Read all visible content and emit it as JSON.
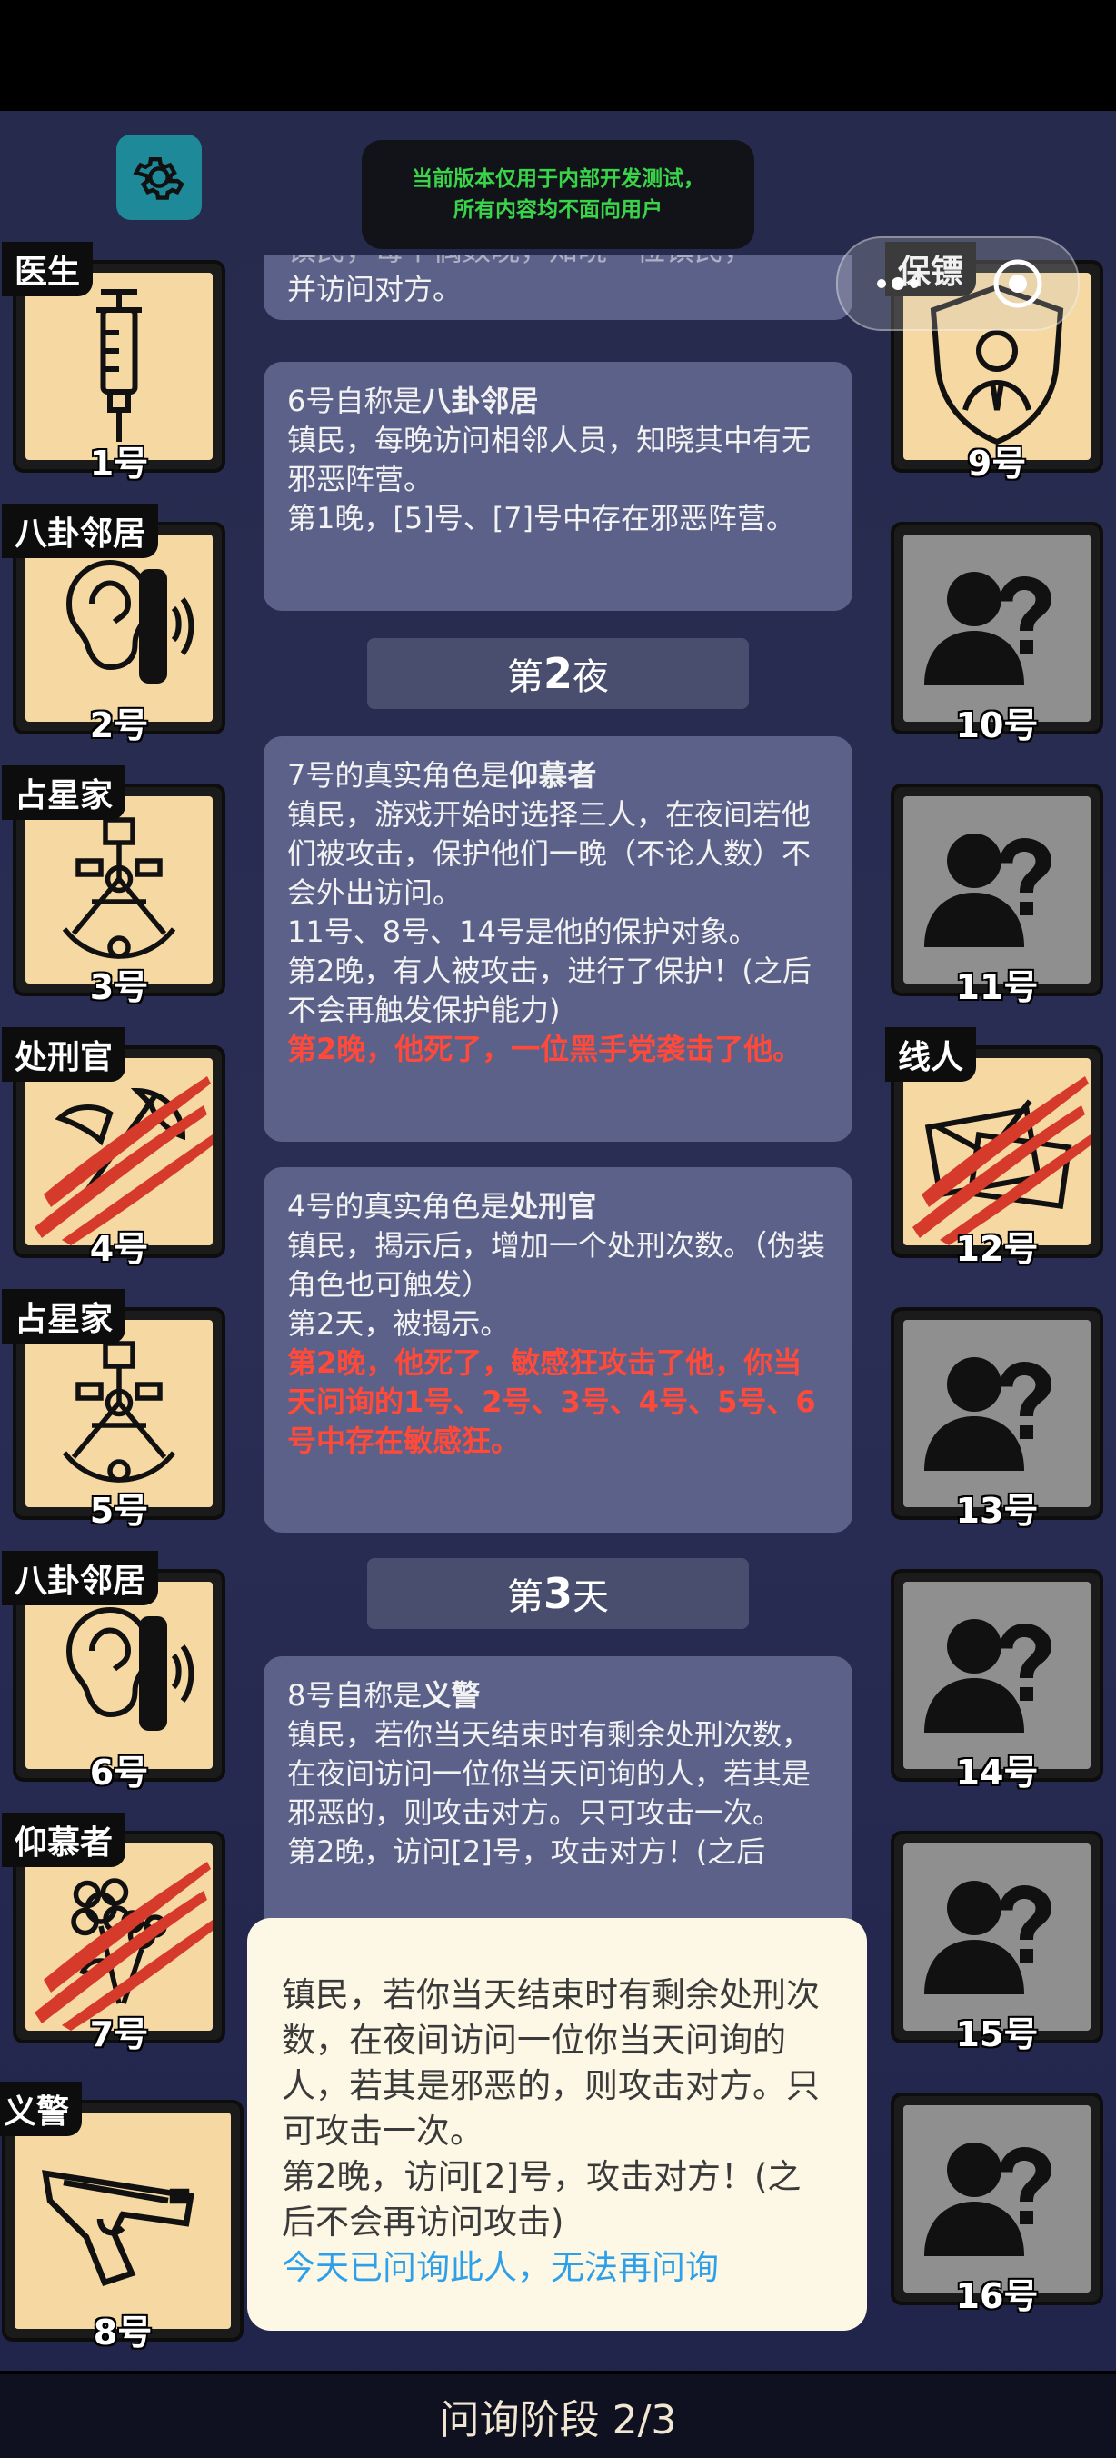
{
  "header": {
    "notice_line1": "当前版本仅用于内部开发测试，",
    "notice_line2": "所有内容均不面向用户"
  },
  "players_left": [
    {
      "role": "医生",
      "num": "1号",
      "icon": "syringe-icon",
      "dead": false
    },
    {
      "role": "八卦邻居",
      "num": "2号",
      "icon": "ear-icon",
      "dead": false
    },
    {
      "role": "占星家",
      "num": "3号",
      "icon": "sextant-icon",
      "dead": false
    },
    {
      "role": "处刑官",
      "num": "4号",
      "icon": "axe-icon",
      "dead": true
    },
    {
      "role": "占星家",
      "num": "5号",
      "icon": "sextant-icon",
      "dead": false
    },
    {
      "role": "八卦邻居",
      "num": "6号",
      "icon": "ear-icon",
      "dead": false
    },
    {
      "role": "仰慕者",
      "num": "7号",
      "icon": "flower-icon",
      "dead": true
    },
    {
      "role": "义警",
      "num": "8号",
      "icon": "pistol-icon",
      "dead": false
    }
  ],
  "players_right": [
    {
      "role": "保镖",
      "num": "9号",
      "icon": "bodyguard-shield-icon",
      "dead": false
    },
    {
      "role": "",
      "num": "10号",
      "icon": "unknown-person-icon",
      "dead": false
    },
    {
      "role": "",
      "num": "11号",
      "icon": "unknown-person-icon",
      "dead": false
    },
    {
      "role": "线人",
      "num": "12号",
      "icon": "envelope-icon",
      "dead": true
    },
    {
      "role": "",
      "num": "13号",
      "icon": "unknown-person-icon",
      "dead": false
    },
    {
      "role": "",
      "num": "14号",
      "icon": "unknown-person-icon",
      "dead": false
    },
    {
      "role": "",
      "num": "15号",
      "icon": "unknown-person-icon",
      "dead": false
    },
    {
      "role": "",
      "num": "16号",
      "icon": "unknown-person-icon",
      "dead": false
    }
  ],
  "feed": {
    "top_partial_line1": "镇民，每个偶数晚，知晓一位镇民，",
    "top_partial_line2": "并访问对方。",
    "entry_6_prefix": "6号自称是",
    "entry_6_role": "八卦邻居",
    "entry_6_desc": "镇民，每晚访问相邻人员，知晓其中有无邪恶阵营。",
    "entry_6_result": "第1晚，[5]号、[7]号中存在邪恶阵营。",
    "night2_prefix": "第",
    "night2_num": "2",
    "night2_suffix": "夜",
    "entry_7_prefix": "7号的真实角色是",
    "entry_7_role": "仰慕者",
    "entry_7_desc": "镇民，游戏开始时选择三人，在夜间若他们被攻击，保护他们一晚（不论人数）不会外出访问。",
    "entry_7_targets": "11号、8号、14号是他的保护对象。",
    "entry_7_event": "第2晚，有人被攻击，进行了保护！(之后不会再触发保护能力)",
    "entry_7_death": "第2晚，他死了，一位黑手党袭击了他。",
    "entry_4_prefix": "4号的真实角色是",
    "entry_4_role": "处刑官",
    "entry_4_desc": "镇民，揭示后，增加一个处刑次数。（伪装角色也可触发）",
    "entry_4_event": "第2天，被揭示。",
    "entry_4_death": "第2晚，他死了，敏感狂攻击了他，你当天问询的1号、2号、3号、4号、5号、6号中存在敏感狂。",
    "day3_prefix": "第",
    "day3_num": "3",
    "day3_suffix": "天",
    "entry_8_prefix": "8号自称是",
    "entry_8_role": "义警",
    "entry_8_desc": "镇民，若你当天结束时有剩余处刑次数，在夜间访问一位你当天问询的人，若其是邪恶的，则攻击对方。只可攻击一次。",
    "entry_8_event": "第2晚，访问[2]号，攻击对方！(之后"
  },
  "popup": {
    "desc": "镇民，若你当天结束时有剩余处刑次数，在夜间访问一位你当天问询的人，若其是邪恶的，则攻击对方。只可攻击一次。",
    "event": "第2晚，访问[2]号，攻击对方！(之后不会再访问攻击)",
    "status": "今天已问询此人，无法再问询"
  },
  "footer": {
    "phase_label": "问询阶段 2/3"
  },
  "colors": {
    "card_bg": "#f6d8a3",
    "unknown_bg": "#8f8f8f",
    "death_text": "#ff4a3a",
    "status_text": "#2ea0ea",
    "notice_text": "#3ad44a"
  }
}
